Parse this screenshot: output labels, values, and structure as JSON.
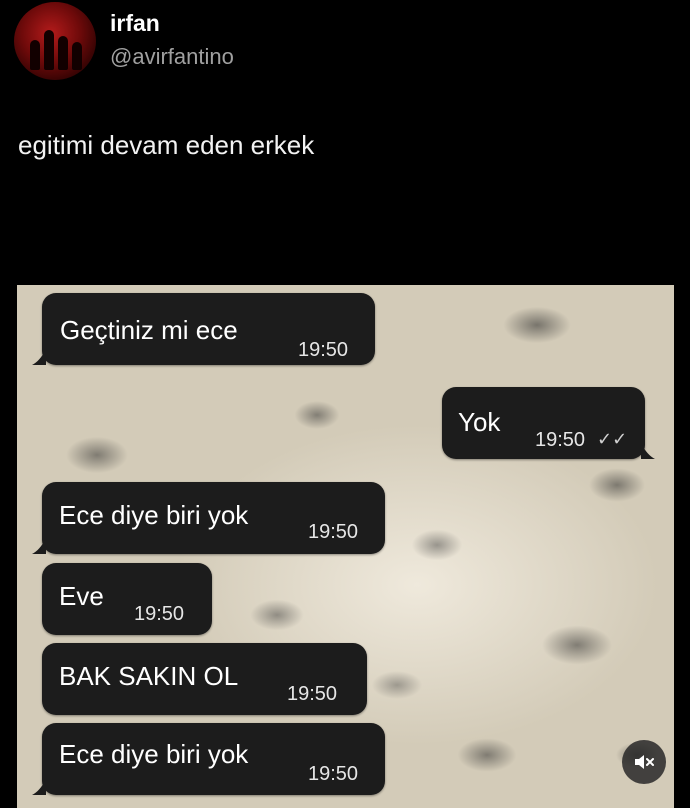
{
  "author": {
    "name": "irfan",
    "handle": "@avirfantino"
  },
  "tweet": {
    "text": "egitimi devam eden erkek"
  },
  "chat": {
    "messages": [
      {
        "direction": "incoming",
        "text": "Geçtiniz mi ece",
        "time": "19:50"
      },
      {
        "direction": "outgoing",
        "text": "Yok",
        "time": "19:50",
        "status_icon": "double-check-icon"
      },
      {
        "direction": "incoming",
        "text": "Ece diye biri yok",
        "time": "19:50"
      },
      {
        "direction": "incoming",
        "text": "Eve",
        "time": "19:50"
      },
      {
        "direction": "incoming",
        "text": "BAK SAKIN OL",
        "time": "19:50"
      },
      {
        "direction": "incoming",
        "text": "Ece diye biri yok",
        "time": "19:50"
      }
    ]
  },
  "media_controls": {
    "mute_icon": "speaker-muted-icon"
  },
  "colors": {
    "background": "#000000",
    "bubble": "#1c1c1c",
    "handle_gray": "#a0a0a0"
  }
}
